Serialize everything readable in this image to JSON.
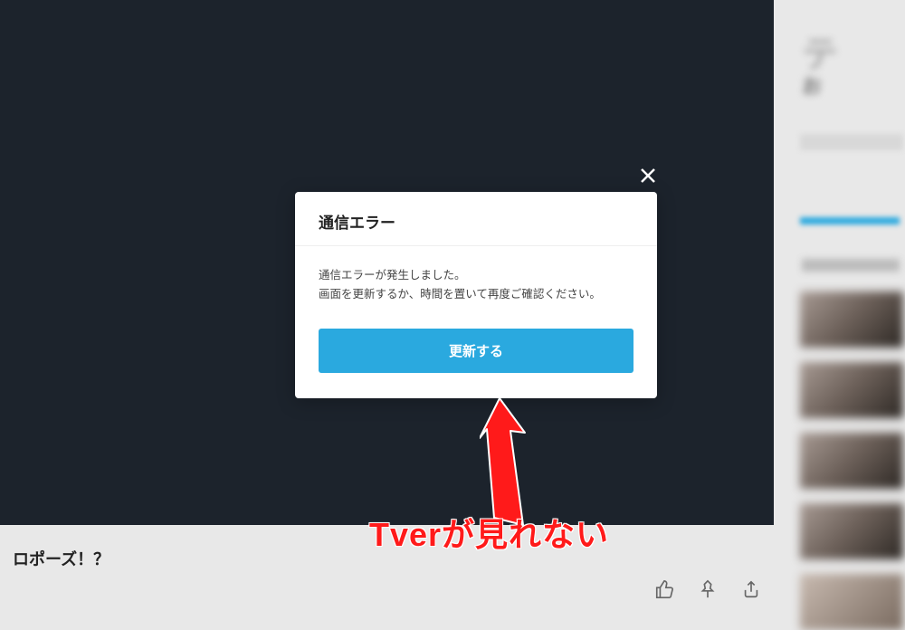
{
  "modal": {
    "title": "通信エラー",
    "message": "通信エラーが発生しました。\n画面を更新するか、時間を置いて再度ご確認ください。",
    "refresh_label": "更新する",
    "close_icon": "close"
  },
  "bottom": {
    "episode_title_fragment": "ロポーズ！？"
  },
  "annotation": {
    "text": "Tverが見れない"
  },
  "colors": {
    "accent": "#2aa9df",
    "player_bg": "#1c232c",
    "annotation_red": "#ff1a1a"
  }
}
